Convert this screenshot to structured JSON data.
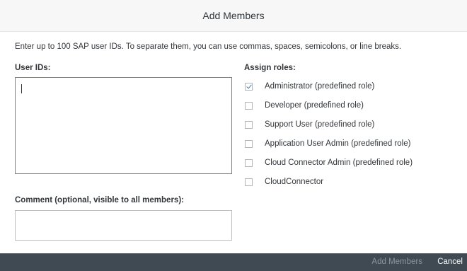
{
  "dialog": {
    "title": "Add Members",
    "instructions": "Enter up to 100 SAP user IDs. To separate them, you can use commas, spaces, semicolons, or line breaks."
  },
  "user_ids": {
    "label": "User IDs:",
    "value": ""
  },
  "roles": {
    "label": "Assign roles:",
    "items": [
      {
        "label": "Administrator (predefined role)",
        "checked": true
      },
      {
        "label": "Developer (predefined role)",
        "checked": false
      },
      {
        "label": "Support User (predefined role)",
        "checked": false
      },
      {
        "label": "Application User Admin (predefined role)",
        "checked": false
      },
      {
        "label": "Cloud Connector Admin (predefined role)",
        "checked": false
      },
      {
        "label": "CloudConnector",
        "checked": false
      }
    ]
  },
  "comment": {
    "label": "Comment (optional, visible to all members):",
    "value": ""
  },
  "footer": {
    "add_label": "Add Members",
    "cancel_label": "Cancel"
  },
  "colors": {
    "header_bg": "#f7f7f7",
    "footer_bg": "#3f4a53",
    "focus_border": "#5b8ab5",
    "check_color": "#427cac",
    "disabled_text": "#8d959b"
  }
}
